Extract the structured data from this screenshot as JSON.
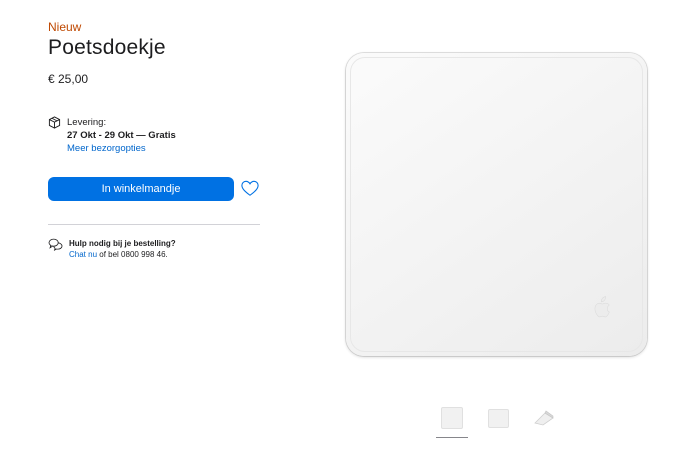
{
  "product": {
    "badge": "Nieuw",
    "title": "Poetsdoekje",
    "price": "€ 25,00"
  },
  "delivery": {
    "label": "Levering:",
    "dates": "27 Okt - 29 Okt — Gratis",
    "link": "Meer bezorgopties",
    "icon": "box-icon"
  },
  "actions": {
    "add_to_bag": "In winkelmandje",
    "favorite_icon": "heart-icon"
  },
  "help": {
    "title": "Hulp nodig bij je bestelling?",
    "chat_link": "Chat nu",
    "rest": " of bel 0800 998 46.",
    "icon": "chat-bubbles-icon"
  },
  "gallery": {
    "thumbnails": [
      "folded-cloth",
      "flat-cloth",
      "angled-cloth"
    ],
    "active_index": 0
  },
  "colors": {
    "badge": "#bf4800",
    "button": "#0071e3",
    "link": "#0066cc"
  }
}
